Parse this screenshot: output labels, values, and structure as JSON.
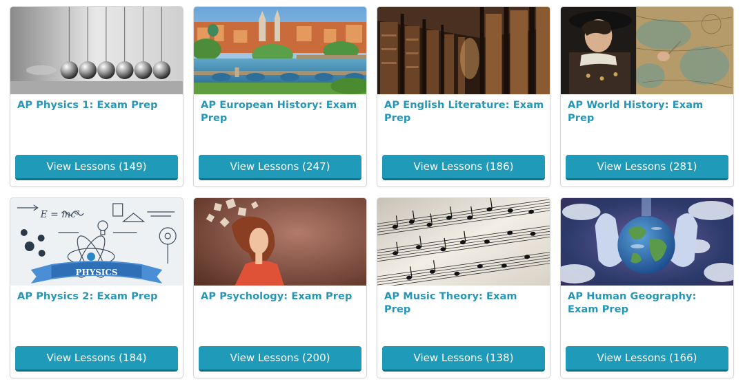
{
  "courses": [
    {
      "title": "AP Physics 1: Exam Prep",
      "button_label": "View Lessons",
      "count": "(149)",
      "image": "newtons-cradle-image"
    },
    {
      "title": "AP European History: Exam Prep",
      "button_label": "View Lessons",
      "count": "(247)",
      "image": "prague-city-image"
    },
    {
      "title": "AP English Literature: Exam Prep",
      "button_label": "View Lessons",
      "count": "(186)",
      "image": "library-hall-image"
    },
    {
      "title": "AP World History: Exam Prep",
      "button_label": "View Lessons",
      "count": "(281)",
      "image": "explorer-map-image"
    },
    {
      "title": "AP Physics 2: Exam Prep",
      "button_label": "View Lessons",
      "count": "(184)",
      "image": "physics-doodle-image"
    },
    {
      "title": "AP Psychology: Exam Prep",
      "button_label": "View Lessons",
      "count": "(200)",
      "image": "puzzle-head-image"
    },
    {
      "title": "AP Music Theory: Exam Prep",
      "button_label": "View Lessons",
      "count": "(138)",
      "image": "sheet-music-image"
    },
    {
      "title": "AP Human Geography: Exam Prep",
      "button_label": "View Lessons",
      "count": "(166)",
      "image": "earth-hands-image"
    }
  ],
  "image_labels": {
    "physics_banner": "PHYSICS",
    "equation": "E = mc²"
  },
  "colors": {
    "title_link": "#2596b8",
    "button_bg": "#1f9ab8",
    "button_shadow": "#12708a",
    "card_border": "#d6d6d6"
  }
}
